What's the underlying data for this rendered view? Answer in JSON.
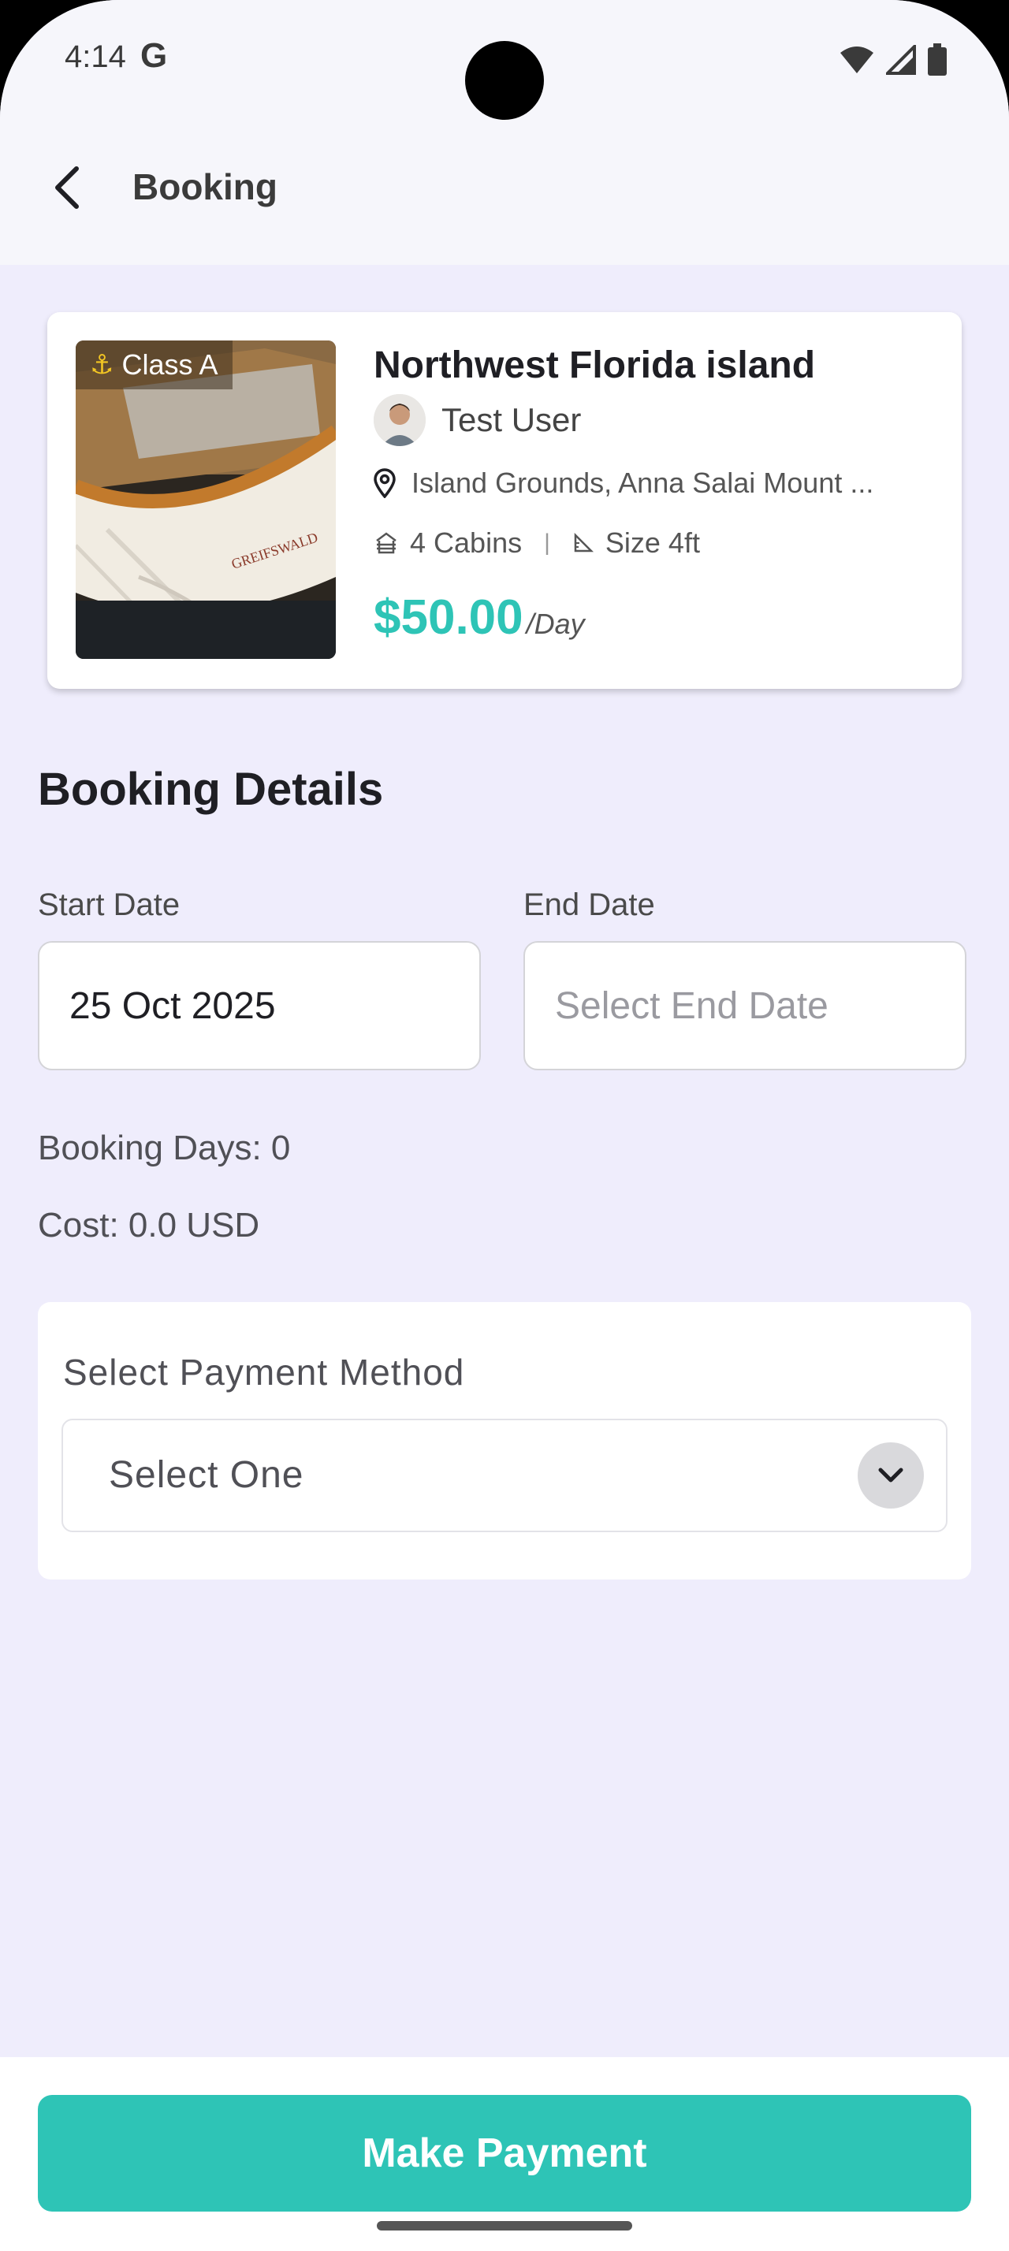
{
  "status_bar": {
    "time": "4:14",
    "g_logo": "G",
    "icons": [
      "wifi-icon",
      "signal-icon",
      "battery-icon"
    ]
  },
  "app_bar": {
    "title": "Booking",
    "back_icon": "chevron-left-icon"
  },
  "boat": {
    "class_badge": "Class A",
    "badge_icon": "anchor-icon",
    "title": "Northwest Florida island",
    "owner_name": "Test User",
    "location": "Island Grounds, Anna Salai Mount ...",
    "cabins": "4 Cabins",
    "size": "Size 4ft",
    "price": "$50.00",
    "price_unit": "/Day"
  },
  "booking": {
    "section_title": "Booking Details",
    "start_label": "Start Date",
    "start_value": "25 Oct 2025",
    "end_label": "End Date",
    "end_placeholder": "Select End Date",
    "days_text": "Booking Days: 0",
    "cost_text": "Cost: 0.0 USD"
  },
  "payment": {
    "label": "Select Payment Method",
    "selected": "Select One"
  },
  "footer": {
    "button_label": "Make Payment"
  },
  "colors": {
    "accent": "#2ec4b6",
    "background": "#efedfc",
    "badge_anchor": "#f3c623"
  }
}
